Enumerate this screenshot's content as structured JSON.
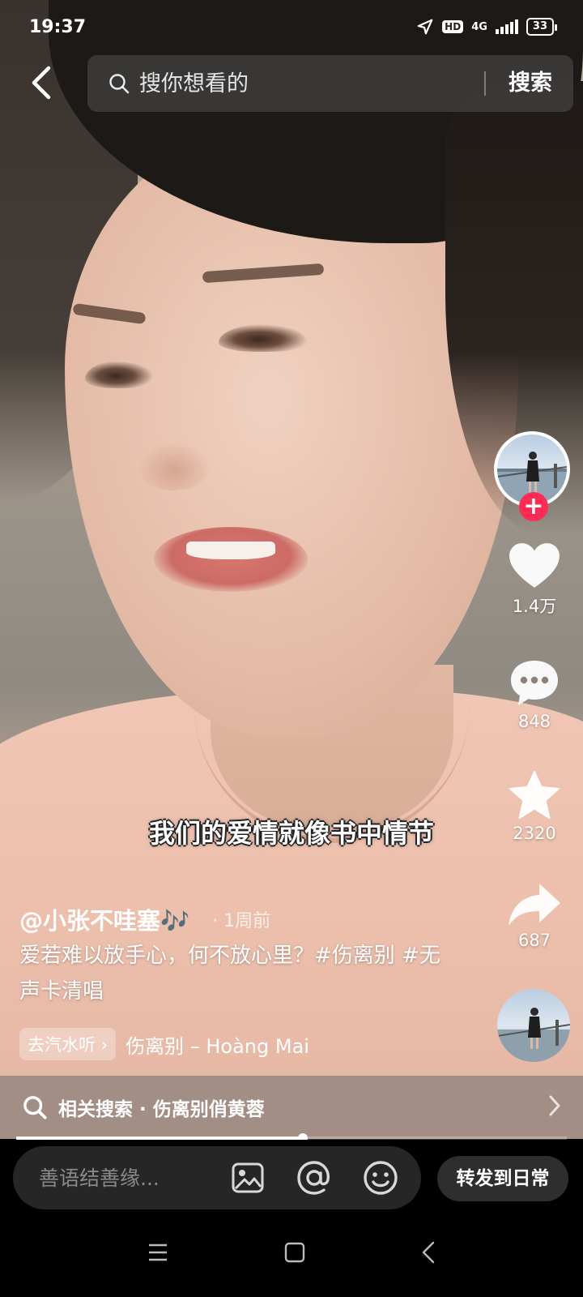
{
  "status_bar": {
    "time": "19:37",
    "hd": "HD",
    "network": "4G",
    "battery": "33"
  },
  "search": {
    "placeholder": "搜你想看的",
    "submit_label": "搜索"
  },
  "video": {
    "subtitle": "我们的爱情就像书中情节"
  },
  "rail": {
    "likes": "1.4万",
    "comments": "848",
    "favorites": "2320",
    "shares": "687"
  },
  "post": {
    "author": "@小张不哇塞🎶",
    "time_dot": "·",
    "time": "1周前",
    "caption": "爱若难以放手心，何不放心里？#伤离别 #无声卡清唱",
    "music_tag": "去汽水听",
    "music_tag_arrow": "›",
    "music_name": "伤离别 – Hoàng Mai"
  },
  "related_search": {
    "label": "相关搜索 · 伤离别俏黄蓉"
  },
  "progress": {
    "value": 0.52
  },
  "comment_bar": {
    "placeholder": "善语结善缘...",
    "share_daily_label": "转发到日常"
  },
  "icons": {
    "back": "chevron-left-icon",
    "search": "search-icon",
    "like": "heart-icon",
    "comment": "comment-dots-icon",
    "favorite": "star-icon",
    "share": "share-arrow-icon",
    "image": "image-icon",
    "mention": "at-icon",
    "emoji": "emoji-icon"
  },
  "colors": {
    "follow": "#fe2c55",
    "comment_box": "#262626"
  }
}
